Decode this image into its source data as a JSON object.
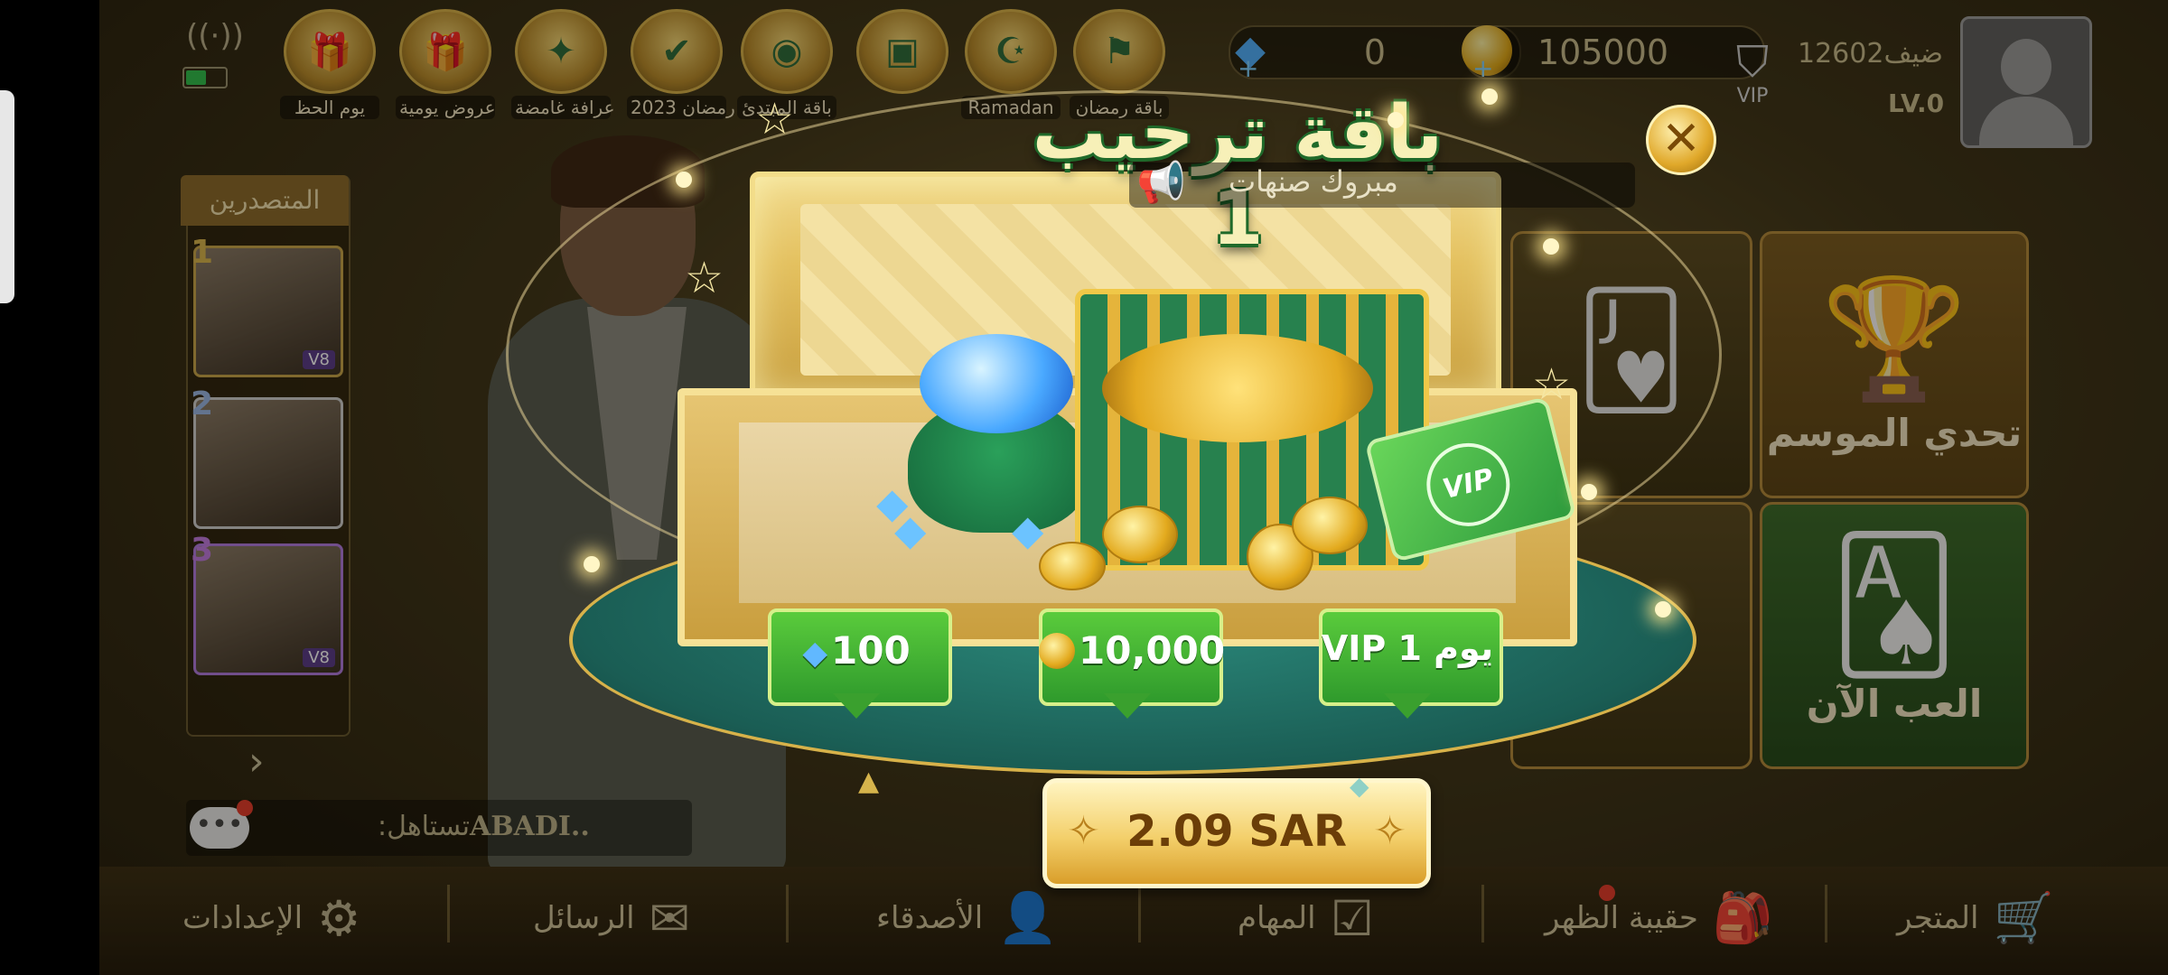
{
  "topbar": {
    "promos": [
      {
        "label": "يوم الحظ",
        "icon": "gift-box-icon"
      },
      {
        "label": "عروض يومية",
        "icon": "gift-box-icon"
      },
      {
        "label": "عرافة غامضة",
        "icon": "fortune-box-icon"
      },
      {
        "label": "رمضان 2023",
        "icon": "ramadan-badge-icon"
      },
      {
        "label": "باقة المبتدئ",
        "icon": "treasure-pile-icon"
      },
      {
        "label": "",
        "icon": "treasure-chest-icon"
      },
      {
        "label": "Ramadan",
        "icon": "lantern-icon"
      },
      {
        "label": "باقة رمضان",
        "icon": "flag-gift-icon"
      }
    ],
    "diamonds": "0",
    "coins": "105000",
    "vip_label": "VIP",
    "player_name": "ضيف12602",
    "player_level": "LV.0"
  },
  "leaderboard": {
    "title": "المتصدرين",
    "entries": [
      {
        "rank": "1",
        "vip": "V8"
      },
      {
        "rank": "2",
        "vip": ""
      },
      {
        "rank": "3",
        "vip": "V8"
      }
    ]
  },
  "chat": {
    "sender": "ABADI..",
    "message": ":تستاهل"
  },
  "tiles": {
    "season_challenge": "تحدي الموسم",
    "play_now": "العب الآن"
  },
  "bottom_nav": [
    {
      "label": "المتجر",
      "icon": "cart-icon"
    },
    {
      "label": "حقيبة الظهر",
      "icon": "backpack-icon"
    },
    {
      "label": "المهام",
      "icon": "tasks-icon"
    },
    {
      "label": "الأصدقاء",
      "icon": "friends-icon"
    },
    {
      "label": "الرسائل",
      "icon": "mail-icon"
    },
    {
      "label": "الإعدادات",
      "icon": "gear-icon"
    }
  ],
  "modal": {
    "title": "باقة ترحيب 1",
    "broadcast": "مبروك صنهات",
    "rewards": {
      "diamonds": "100",
      "coins": "10,000",
      "vip": "VIP 1 يوم"
    },
    "price": "2.09 SAR"
  },
  "colors": {
    "gold": "#e3aa1e",
    "green": "#2f9a2c",
    "title_outline": "#1f6a2a",
    "price_text": "#6b3e08"
  }
}
